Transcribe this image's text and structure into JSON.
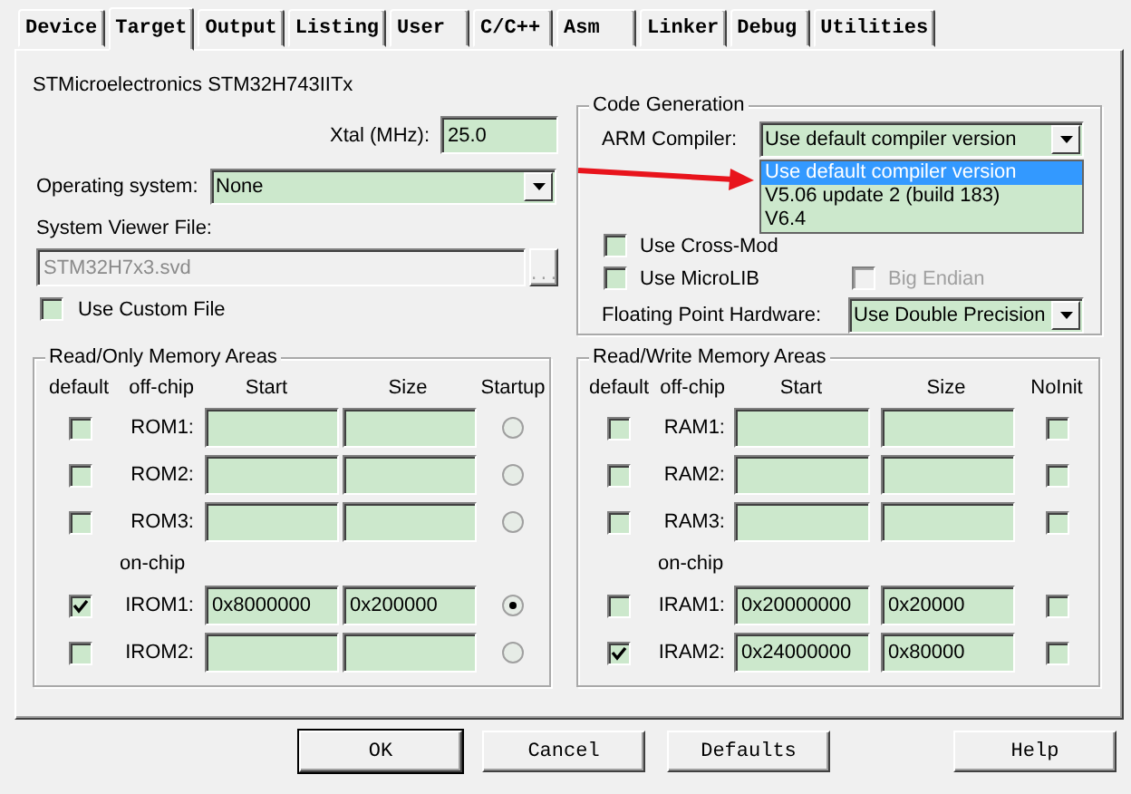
{
  "tabs": [
    {
      "label": "Device",
      "selected": false
    },
    {
      "label": "Target",
      "selected": true
    },
    {
      "label": "Output",
      "selected": false
    },
    {
      "label": "Listing",
      "selected": false
    },
    {
      "label": "User",
      "selected": false
    },
    {
      "label": "C/C++",
      "selected": false
    },
    {
      "label": "Asm",
      "selected": false
    },
    {
      "label": "Linker",
      "selected": false
    },
    {
      "label": "Debug",
      "selected": false
    },
    {
      "label": "Utilities",
      "selected": false
    }
  ],
  "device": "STMicroelectronics STM32H743IITx",
  "xtal": {
    "label": "Xtal (MHz):",
    "value": "25.0"
  },
  "operating_system": {
    "label": "Operating system:",
    "value": "None"
  },
  "system_viewer_file": {
    "label": "System Viewer File:",
    "value": "STM32H7x3.svd",
    "disabled": true,
    "browse": "..."
  },
  "use_custom_file": {
    "label": "Use Custom File",
    "checked": false
  },
  "code_generation": {
    "title": "Code Generation",
    "arm_compiler": {
      "label": "ARM Compiler:",
      "value": "Use default compiler version",
      "expanded": true,
      "options": [
        {
          "label": "Use default compiler version",
          "selected": true
        },
        {
          "label": "V5.06 update 2 (build 183)",
          "selected": false
        },
        {
          "label": "V6.4",
          "selected": false
        }
      ]
    },
    "options": [
      {
        "label": "Use Cross-Mod",
        "checked": false,
        "disabled": false
      },
      {
        "label": "Use MicroLIB",
        "checked": false,
        "disabled": false
      },
      {
        "label": "Big Endian",
        "checked": false,
        "disabled": true
      }
    ],
    "floating_point": {
      "label": "Floating Point Hardware:",
      "value": "Use Double Precision"
    }
  },
  "annotation_arrow": true,
  "memory_groups": [
    {
      "title": "Read/Only Memory Areas",
      "kind": "radio",
      "columns": [
        "default",
        "off-chip",
        "Start",
        "Size",
        "Startup"
      ],
      "on_chip_label": "on-chip",
      "off_chip": [
        {
          "label": "ROM1:",
          "default": false,
          "startup": false
        },
        {
          "label": "ROM2:",
          "default": false,
          "startup": false
        },
        {
          "label": "ROM3:",
          "default": false,
          "startup": false
        }
      ],
      "on_chip": [
        {
          "label": "IROM1:",
          "default": true,
          "start": "0x8000000",
          "size": "0x200000",
          "startup": true
        },
        {
          "label": "IROM2:",
          "default": false,
          "startup": false
        }
      ]
    },
    {
      "title": "Read/Write Memory Areas",
      "kind": "checkbox",
      "columns": [
        "default",
        "off-chip",
        "Start",
        "Size",
        "NoInit"
      ],
      "on_chip_label": "on-chip",
      "off_chip": [
        {
          "label": "RAM1:",
          "default": false,
          "noinit": false
        },
        {
          "label": "RAM2:",
          "default": false,
          "noinit": false
        },
        {
          "label": "RAM3:",
          "default": false,
          "noinit": false
        }
      ],
      "on_chip": [
        {
          "label": "IRAM1:",
          "default": false,
          "start": "0x20000000",
          "size": "0x20000",
          "noinit": false
        },
        {
          "label": "IRAM2:",
          "default": true,
          "start": "0x24000000",
          "size": "0x80000",
          "noinit": false
        }
      ]
    }
  ],
  "buttons": [
    "OK",
    "Cancel",
    "Defaults",
    "Help"
  ]
}
